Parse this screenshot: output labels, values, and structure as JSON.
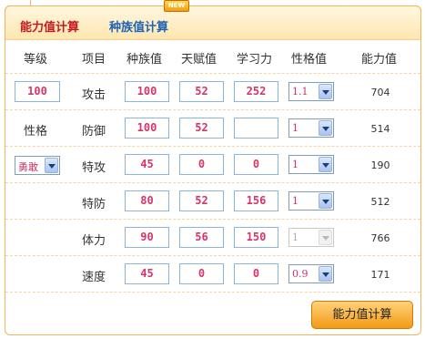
{
  "tabs": {
    "active": "能力值计算",
    "inactive": "种族值计算",
    "new_badge": "NEW"
  },
  "columns": [
    "等级",
    "项目",
    "种族值",
    "天赋值",
    "学习力",
    "性格值",
    "能力值"
  ],
  "level": "100",
  "nature_label": "性格",
  "nature_value": "勇敢",
  "rows": [
    {
      "stat": "攻击",
      "base": "100",
      "iv": "52",
      "ev": "252",
      "modifier": "1.1",
      "result": "704",
      "modifier_disabled": false
    },
    {
      "stat": "防御",
      "base": "100",
      "iv": "52",
      "ev": "",
      "modifier": "1",
      "result": "514",
      "modifier_disabled": false
    },
    {
      "stat": "特攻",
      "base": "45",
      "iv": "0",
      "ev": "0",
      "modifier": "1",
      "result": "190",
      "modifier_disabled": false
    },
    {
      "stat": "特防",
      "base": "80",
      "iv": "52",
      "ev": "156",
      "modifier": "1",
      "result": "512",
      "modifier_disabled": false
    },
    {
      "stat": "体力",
      "base": "90",
      "iv": "56",
      "ev": "150",
      "modifier": "1",
      "result": "766",
      "modifier_disabled": true
    },
    {
      "stat": "速度",
      "base": "45",
      "iv": "0",
      "ev": "0",
      "modifier": "0.9",
      "result": "171",
      "modifier_disabled": false
    }
  ],
  "calculate_button": "能力值计算",
  "colors": {
    "accent_red": "#c8161d",
    "accent_blue": "#1f63b6",
    "border_orange": "#f0b45c",
    "value_pink": "#d8336b"
  }
}
